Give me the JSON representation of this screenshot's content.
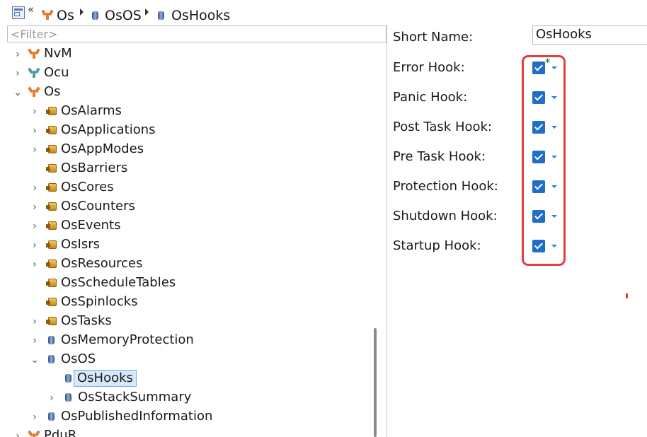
{
  "breadcrumb": {
    "back_glyph": "«",
    "items": [
      "Os",
      "OsOS",
      "OsHooks"
    ]
  },
  "filter": {
    "placeholder": "<Filter>"
  },
  "tree": {
    "nodes": [
      {
        "label": "NvM",
        "icon": "module-icon",
        "expander": "collapsed"
      },
      {
        "label": "Ocu",
        "icon": "module-icon",
        "expander": "collapsed"
      },
      {
        "label": "Os",
        "icon": "module-icon",
        "expander": "expanded"
      },
      {
        "label": "OsAlarms",
        "icon": "container-icon",
        "expander": "collapsed"
      },
      {
        "label": "OsApplications",
        "icon": "container-icon",
        "expander": "collapsed"
      },
      {
        "label": "OsAppModes",
        "icon": "container-icon",
        "expander": "collapsed"
      },
      {
        "label": "OsBarriers",
        "icon": "container-icon",
        "expander": "none"
      },
      {
        "label": "OsCores",
        "icon": "container-icon",
        "expander": "collapsed"
      },
      {
        "label": "OsCounters",
        "icon": "container-icon",
        "expander": "collapsed"
      },
      {
        "label": "OsEvents",
        "icon": "container-icon",
        "expander": "collapsed"
      },
      {
        "label": "OsIsrs",
        "icon": "container-icon",
        "expander": "collapsed"
      },
      {
        "label": "OsResources",
        "icon": "container-icon",
        "expander": "collapsed"
      },
      {
        "label": "OsScheduleTables",
        "icon": "container-icon",
        "expander": "none"
      },
      {
        "label": "OsSpinlocks",
        "icon": "container-icon",
        "expander": "none"
      },
      {
        "label": "OsTasks",
        "icon": "container-icon",
        "expander": "collapsed"
      },
      {
        "label": "OsMemoryProtection",
        "icon": "cylinder-icon",
        "expander": "collapsed"
      },
      {
        "label": "OsOS",
        "icon": "cylinder-icon",
        "expander": "expanded"
      },
      {
        "label": "OsHooks",
        "icon": "cylinder-icon",
        "expander": "none",
        "selected": true
      },
      {
        "label": "OsStackSummary",
        "icon": "cylinder-icon",
        "expander": "collapsed"
      },
      {
        "label": "OsPublishedInformation",
        "icon": "cylinder-icon",
        "expander": "collapsed"
      },
      {
        "label": "PduR",
        "icon": "module-icon",
        "expander": "collapsed"
      }
    ]
  },
  "properties": {
    "short_name_label": "Short Name:",
    "short_name_value": "OsHooks",
    "hooks": [
      {
        "label": "Error Hook:",
        "checked": true,
        "modified": true
      },
      {
        "label": "Panic Hook:",
        "checked": true
      },
      {
        "label": "Post Task Hook:",
        "checked": true
      },
      {
        "label": "Pre Task Hook:",
        "checked": true
      },
      {
        "label": "Protection Hook:",
        "checked": true
      },
      {
        "label": "Shutdown Hook:",
        "checked": true
      },
      {
        "label": "Startup Hook:",
        "checked": true
      }
    ],
    "modified_marker": "*"
  },
  "colors": {
    "accent_blue": "#1f6ec8",
    "highlight_red": "#e0413a",
    "module_orange": "#e27a2f",
    "module_teal": "#4a9aa6",
    "selection_bg": "#d6e8fb"
  }
}
